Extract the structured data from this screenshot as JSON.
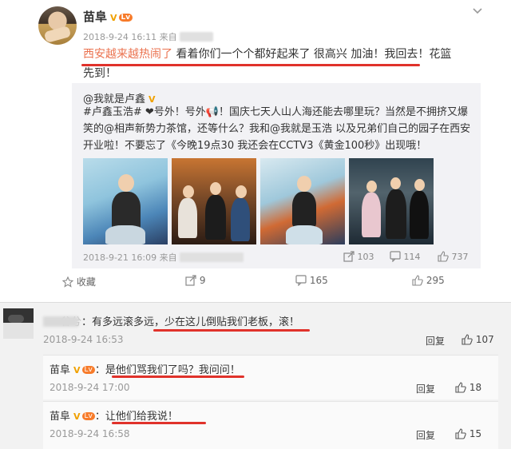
{
  "post": {
    "author": "苗阜",
    "v_badge": "V",
    "level_badge": "Lv",
    "time": "2018-9-24 16:11 来自",
    "text_highlight": "西安越来越热闹了",
    "text_rest": "看着你们一个个都好起来了 很高兴 加油！我回去！花篮先到！"
  },
  "repost": {
    "author": "@我就是卢鑫",
    "v_badge": "V",
    "text": "#卢鑫玉浩# ❤号外！号外📢！国庆七天人山人海还能去哪里玩？当然是不拥挤又爆笑的@相声新势力茶馆，还等什么？我和@我就是玉浩 以及兄弟们自己的园子在西安开业啦！不要忘了《今晚19点30 我还会在CCTV3《黄金100秒》出现哦！",
    "time": "2018-9-21 16:09 来自",
    "forwards": "103",
    "comments": "114",
    "likes": "737",
    "watermark": "@新浪娱乐"
  },
  "actions": {
    "favorite": "收藏",
    "forward": "9",
    "comment": "165",
    "like": "295"
  },
  "comments": [
    {
      "name": "谷兮",
      "text": "：有多远滚多远，少在这儿倒贴我们老板，滚！",
      "time": "2018-9-24 16:53",
      "reply": "回复",
      "likes": "107"
    }
  ],
  "replies": [
    {
      "name": "苗阜",
      "v_badge": "V",
      "text": "：是他们骂我们了吗？我问问！",
      "time": "2018-9-24 17:00",
      "reply": "回复",
      "likes": "18"
    },
    {
      "name": "苗阜",
      "v_badge": "V",
      "text": "：让他们给我说！",
      "time": "2018-9-24 16:58",
      "reply": "回复",
      "likes": "15"
    }
  ],
  "colors": {
    "accent": "#eb7350",
    "underline": "#e0322b",
    "vip": "#f0a100"
  }
}
